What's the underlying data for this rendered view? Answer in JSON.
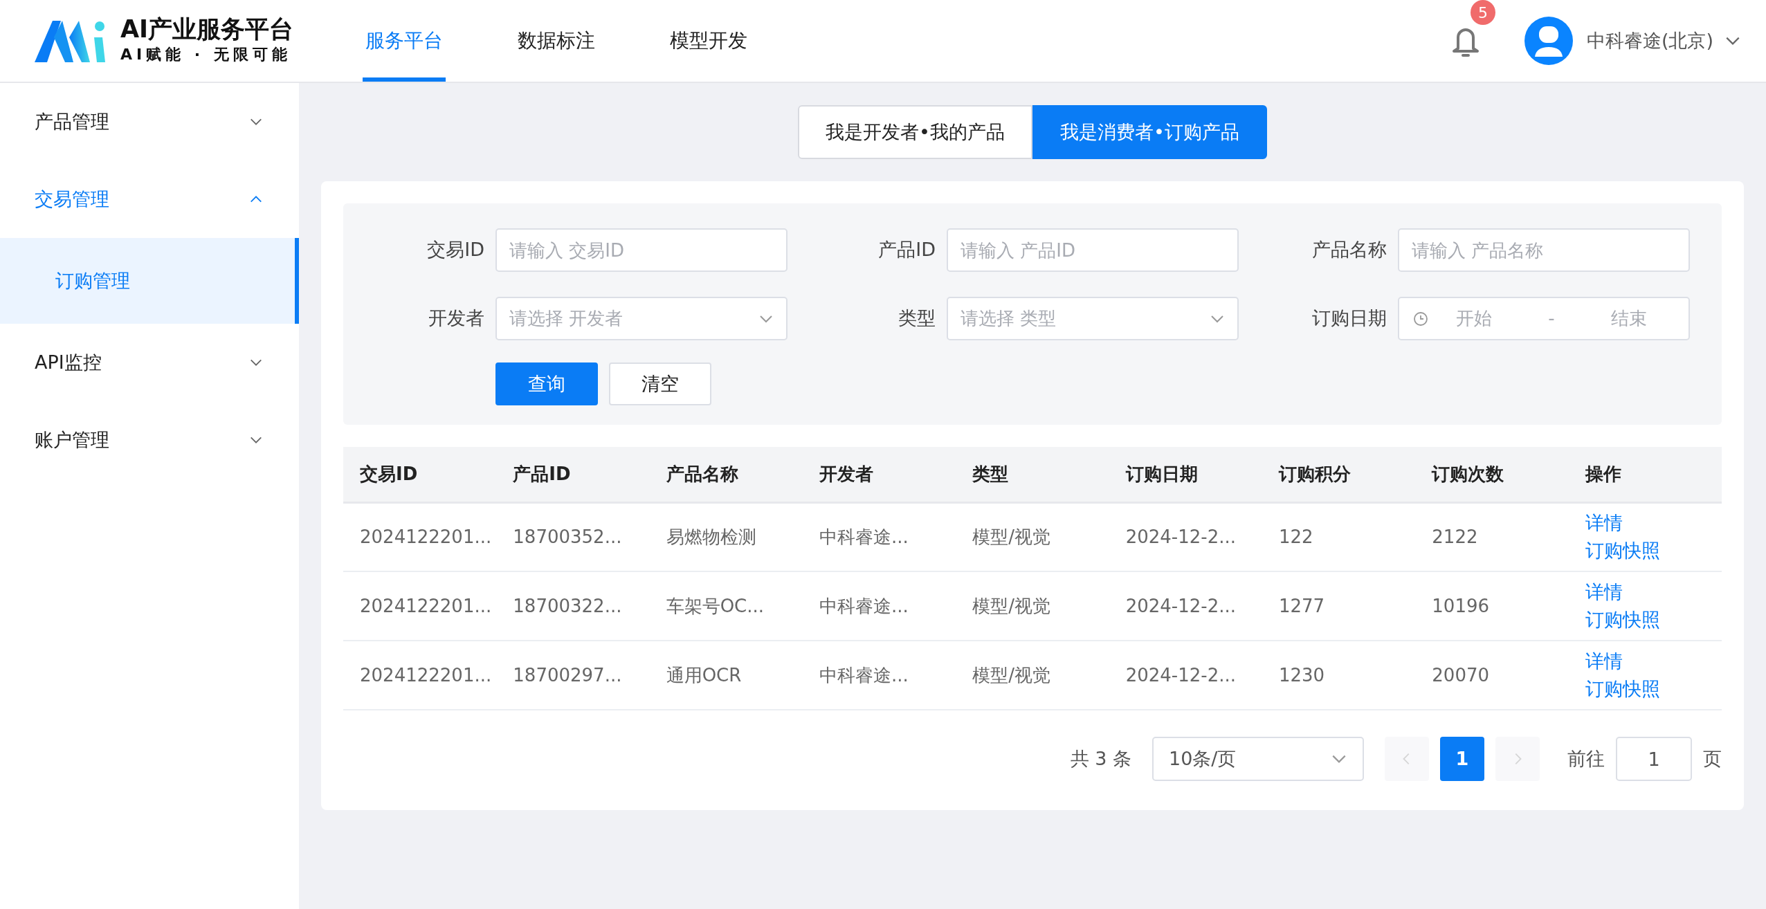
{
  "app": {
    "title": "AI产业服务平台",
    "slogan": "AI赋能 · 无限可能"
  },
  "top_nav": [
    {
      "label": "服务平台",
      "selected": true
    },
    {
      "label": "数据标注",
      "selected": false
    },
    {
      "label": "模型开发",
      "selected": false
    }
  ],
  "notifications": {
    "count": "5"
  },
  "user": {
    "name": "中科睿途(北京)"
  },
  "sidebar": {
    "items": [
      {
        "label": "产品管理",
        "selected": false,
        "expanded": false
      },
      {
        "label": "交易管理",
        "selected": true,
        "expanded": true,
        "children": [
          {
            "label": "订购管理",
            "selected": true
          }
        ]
      },
      {
        "label": "API监控",
        "selected": false,
        "expanded": false
      },
      {
        "label": "账户管理",
        "selected": false,
        "expanded": false
      }
    ]
  },
  "role_tabs": [
    {
      "label": "我是开发者•我的产品",
      "selected": false
    },
    {
      "label": "我是消费者•订购产品",
      "selected": true
    }
  ],
  "filters": [
    {
      "kind": "input",
      "label": "交易ID",
      "placeholder": "请输入 交易ID"
    },
    {
      "kind": "input",
      "label": "产品ID",
      "placeholder": "请输入 产品ID"
    },
    {
      "kind": "input",
      "label": "产品名称",
      "placeholder": "请输入 产品名称"
    },
    {
      "kind": "select",
      "label": "开发者",
      "placeholder": "请选择 开发者"
    },
    {
      "kind": "select",
      "label": "类型",
      "placeholder": "请选择 类型"
    },
    {
      "kind": "daterange",
      "label": "订购日期",
      "start_placeholder": "开始",
      "separator": "-",
      "end_placeholder": "结束"
    }
  ],
  "buttons": [
    {
      "label": "查询",
      "kind": "primary"
    },
    {
      "label": "清空",
      "kind": "default"
    }
  ],
  "table": {
    "columns": [
      "交易ID",
      "产品ID",
      "产品名称",
      "开发者",
      "类型",
      "订购日期",
      "订购积分",
      "订购次数",
      "操作"
    ],
    "rows": [
      {
        "cells": [
          "2024122201...",
          "18700352...",
          "易燃物检测",
          "中科睿途...",
          "模型/视觉",
          "2024-12-2...",
          "122",
          "2122"
        ],
        "actions": [
          "详情",
          "订购快照"
        ]
      },
      {
        "cells": [
          "2024122201...",
          "18700322...",
          "车架号OC...",
          "中科睿途...",
          "模型/视觉",
          "2024-12-2...",
          "1277",
          "10196"
        ],
        "actions": [
          "详情",
          "订购快照"
        ]
      },
      {
        "cells": [
          "2024122201...",
          "18700297...",
          "通用OCR",
          "中科睿途...",
          "模型/视觉",
          "2024-12-2...",
          "1230",
          "20070"
        ],
        "actions": [
          "详情",
          "订购快照"
        ]
      }
    ]
  },
  "pagination": {
    "total": "共 3 条",
    "page_size": "10条/页",
    "prev_disabled": true,
    "next_disabled": true,
    "pages": [
      {
        "label": "1",
        "selected": true
      }
    ],
    "goto_label": "前往",
    "goto_value": "1",
    "page_suffix": "页"
  }
}
